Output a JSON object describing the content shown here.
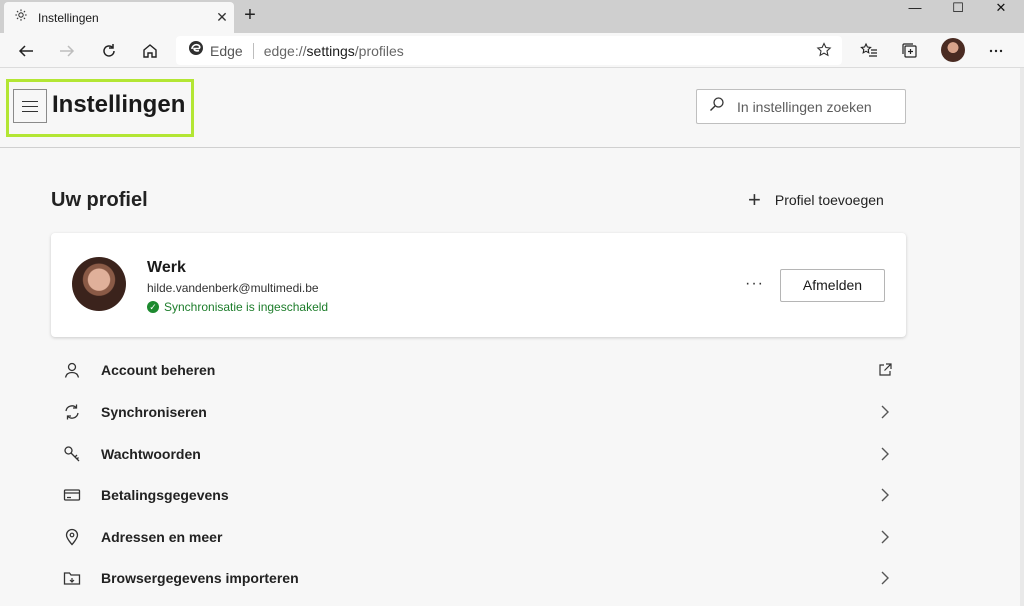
{
  "tab": {
    "title": "Instellingen",
    "close": "✕",
    "new_tab": "+"
  },
  "window_controls": {
    "minimize": "—",
    "maximize": "☐",
    "close": "✕"
  },
  "address_bar": {
    "brand": "Edge",
    "url_prefix": "edge://",
    "url_host": "settings",
    "url_path": "/profiles"
  },
  "header": {
    "title": "Instellingen",
    "search_placeholder": "In instellingen zoeken"
  },
  "profile_section": {
    "title": "Uw profiel",
    "add_profile": "Profiel toevoegen",
    "profile": {
      "name": "Werk",
      "email": "hilde.vandenberk@multimedi.be",
      "sync_status": "Synchronisatie is ingeschakeld",
      "more": "···",
      "signout": "Afmelden"
    }
  },
  "menu_items": [
    {
      "label": "Account beheren",
      "icon": "person-icon",
      "trailing": "external-link-icon"
    },
    {
      "label": "Synchroniseren",
      "icon": "sync-icon",
      "trailing": "chevron-right-icon"
    },
    {
      "label": "Wachtwoorden",
      "icon": "key-icon",
      "trailing": "chevron-right-icon"
    },
    {
      "label": "Betalingsgegevens",
      "icon": "card-icon",
      "trailing": "chevron-right-icon"
    },
    {
      "label": "Adressen en meer",
      "icon": "location-pin-icon",
      "trailing": "chevron-right-icon"
    },
    {
      "label": "Browsergegevens importeren",
      "icon": "import-folder-icon",
      "trailing": "chevron-right-icon"
    }
  ],
  "colors": {
    "highlight": "#b3e634",
    "sync_green": "#1d7d2b"
  }
}
